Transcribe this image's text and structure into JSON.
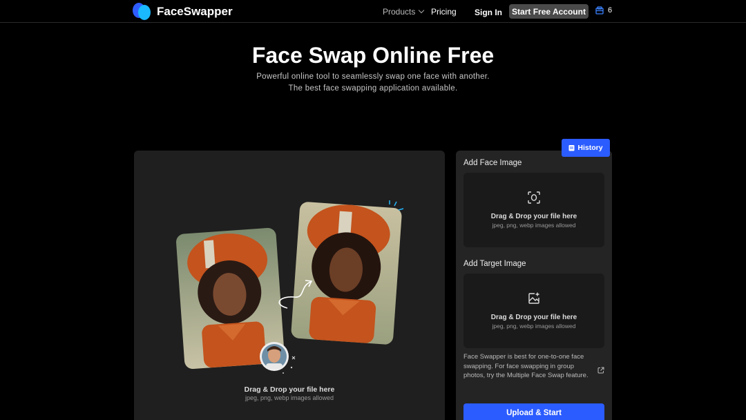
{
  "header": {
    "brand": "FaceSwapper",
    "nav": {
      "products": "Products",
      "pricing": "Pricing",
      "sign_in": "Sign In"
    },
    "cta": "Start Free Account",
    "credits": "6"
  },
  "hero": {
    "title": "Face Swap Online Free",
    "subtitle_line1": "Powerful online tool to seamlessly swap one face with another.",
    "subtitle_line2": "The best face swapping application available."
  },
  "left_panel": {
    "drop_title": "Drag & Drop your file here",
    "drop_sub": "jpeg, png, webp images allowed"
  },
  "right_panel": {
    "history": "History",
    "face": {
      "label": "Add Face Image",
      "drop_title": "Drag & Drop your file here",
      "drop_sub": "jpeg, png, webp images allowed"
    },
    "target": {
      "label": "Add Target Image",
      "drop_title": "Drag & Drop your file here",
      "drop_sub": "jpeg, png, webp images allowed"
    },
    "note": "Face Swapper is best for one-to-one face swapping. For face swapping in group photos, try the Multiple Face Swap feature.",
    "upload": "Upload & Start"
  },
  "colors": {
    "accent": "#2b5cff",
    "panel": "#1f1f1f",
    "logo_light": "#1ab8ff"
  }
}
